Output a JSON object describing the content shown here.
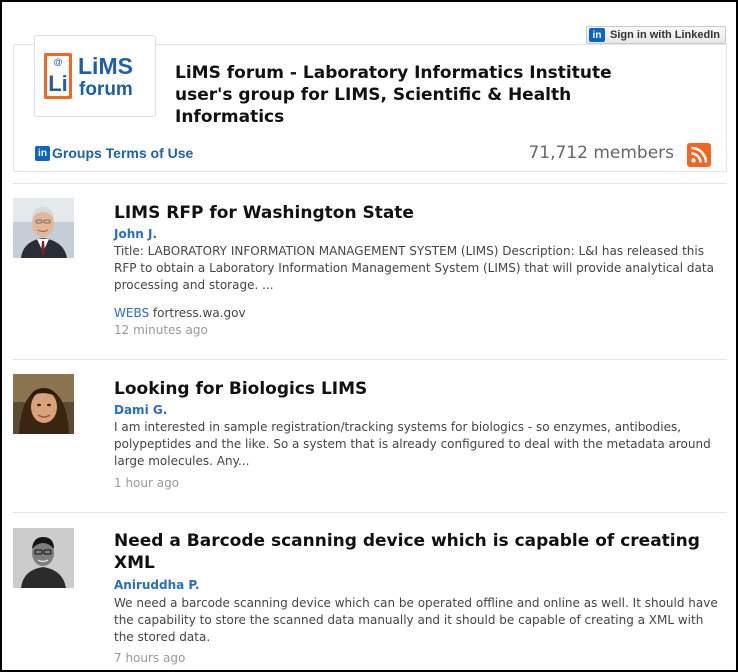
{
  "signin": {
    "label": "Sign in with LinkedIn",
    "badge": "in"
  },
  "group": {
    "logo_text_1": "LiMS",
    "logo_text_2": "forum",
    "logo_mark": "Li",
    "logo_at": "@",
    "title": "LiMS forum - Laboratory Informatics Institute user's group for LIMS, Scientific & Health Informatics",
    "terms_badge": "in",
    "terms_label": "Groups Terms of Use",
    "members": "71,712 members",
    "rss_icon": "rss-icon",
    "brand_orange": "#f26522",
    "linkedin_blue": "#0a66c2"
  },
  "posts": [
    {
      "title": "LIMS RFP for Washington State",
      "author": "John J.",
      "description": "Title: LABORATORY INFORMATION MANAGEMENT SYSTEM (LIMS) Description: L&I has released this RFP to obtain a Laboratory Information Management System (LIMS) that will provide analytical data processing and storage. ...",
      "source_tag": "WEBS",
      "source_domain": "fortress.wa.gov",
      "time": "12 minutes ago"
    },
    {
      "title": "Looking for Biologics LIMS",
      "author": "Dami G.",
      "description": "I am interested in sample registration/tracking systems for biologics - so enzymes, antibodies, polypeptides and the like. So a system that is already configured to deal with the metadata around large molecules. Any...",
      "time": "1 hour ago"
    },
    {
      "title": "Need a Barcode scanning device which is capable of creating XML",
      "author": "Aniruddha P.",
      "description": "We need a barcode scanning device which can be operated offline and online as well. It should have the capability to store the scanned data manually and it should be capable of creating a XML with the stored data.",
      "time": "7 hours ago"
    }
  ]
}
